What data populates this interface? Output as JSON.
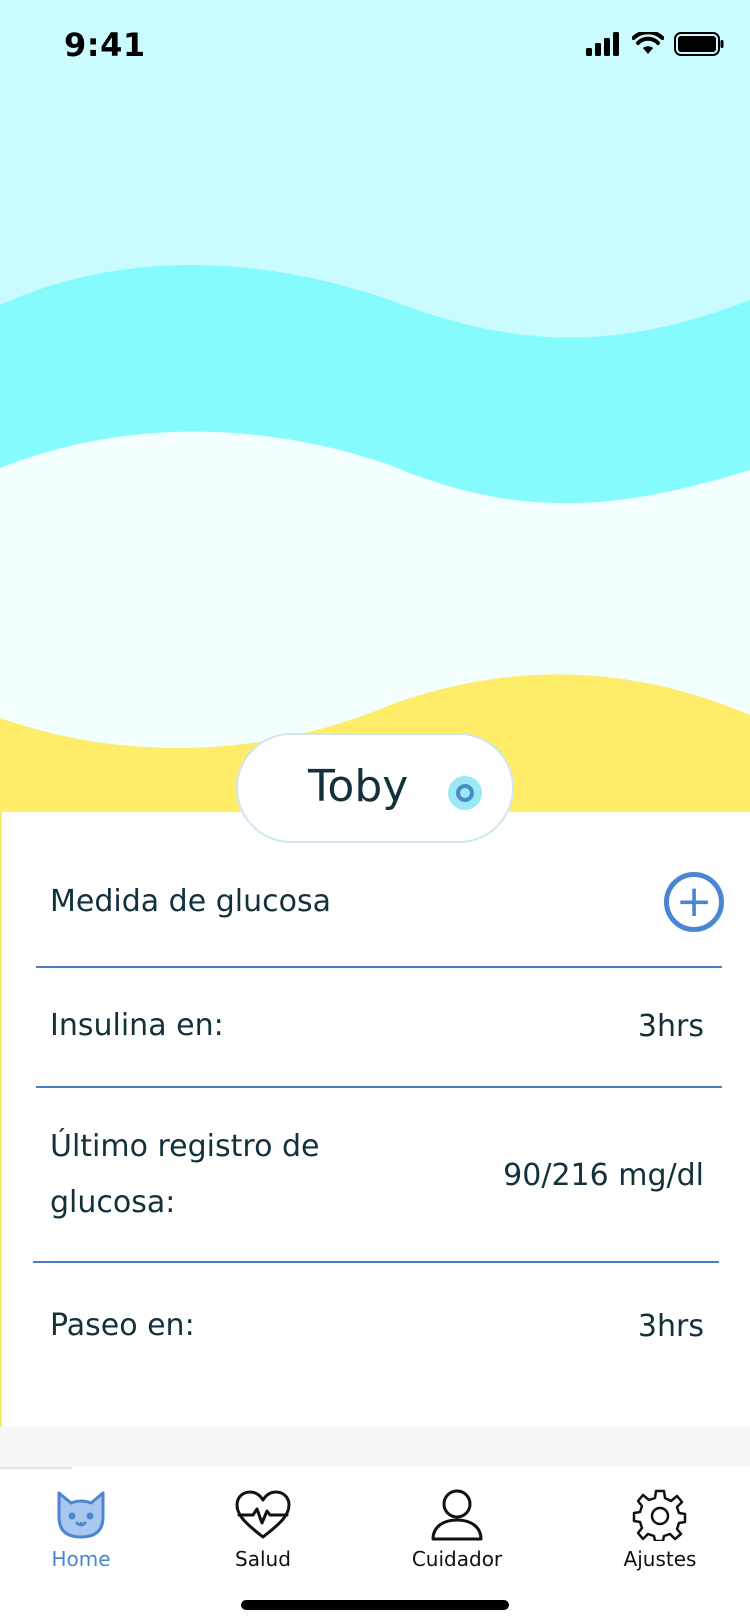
{
  "status_bar": {
    "time": "9:41"
  },
  "colors": {
    "sky_light": "#c9fbff",
    "wave_cyan": "#86fbfd",
    "wave_pale": "#f3feff",
    "sand_yellow": "#ffec69",
    "accent_blue": "#4a86d1",
    "text_dark": "#13313d"
  },
  "pet": {
    "name": "Toby"
  },
  "rows": [
    {
      "label": "Medida de glucosa",
      "action_icon": "plus-circle-icon"
    },
    {
      "label": "Insulina en:",
      "value": "3hrs"
    },
    {
      "label_line1": "Último registro de",
      "label_line2": "glucosa:",
      "value": "90/216 mg/dl"
    },
    {
      "label": "Paseo en:",
      "value": "3hrs"
    }
  ],
  "tabs": [
    {
      "label": "Home",
      "icon": "cat-face-icon",
      "active": true
    },
    {
      "label": "Salud",
      "icon": "heart-pulse-icon",
      "active": false
    },
    {
      "label": "Cuidador",
      "icon": "person-icon",
      "active": false
    },
    {
      "label": "Ajustes",
      "icon": "gear-icon",
      "active": false
    }
  ]
}
